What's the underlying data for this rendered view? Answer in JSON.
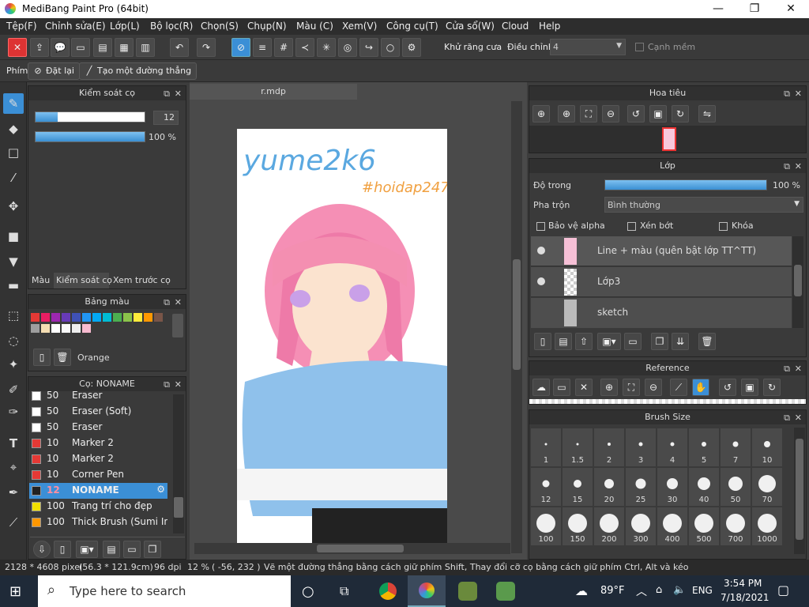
{
  "window": {
    "title": "MediBang Paint Pro (64bit)",
    "minimize": "—",
    "maximize": "❐",
    "close": "✕"
  },
  "menu": [
    "Tệp(F)",
    "Chỉnh sửa(E)",
    "Lớp(L)",
    "Bộ lọc(R)",
    "Chọn(S)",
    "Chụp(N)",
    "Màu (C)",
    "Xem(V)",
    "Công cụ(T)",
    "Cửa sổ(W)",
    "Cloud",
    "Help"
  ],
  "toolbar": {
    "antialias_label": "Khử răng cưa",
    "antialias_checked": true,
    "adjust_label": "Điều chỉnh",
    "adjust_value": "4",
    "soft_edge_label": "Cạnh mềm",
    "soft_edge_checked": false
  },
  "subbar": {
    "label": "Phím",
    "reset": "Đặt lại",
    "straight_line": "Tạo một đường thẳng"
  },
  "brush_control": {
    "title": "Kiểm soát cọ",
    "size": "12",
    "size_fill": 0.2,
    "opacity": "100 %",
    "opacity_fill": 1.0,
    "tabs": [
      "Màu",
      "Kiểm soát cọ",
      "Xem trước cọ"
    ]
  },
  "palette": {
    "title": "Bảng màu",
    "colors": [
      "#e53935",
      "#e91e63",
      "#9c27b0",
      "#673ab7",
      "#3f51b5",
      "#2196f3",
      "#03a9f4",
      "#00bcd4",
      "#4caf50",
      "#8bc34a",
      "#ffeb3b",
      "#ff9800",
      "#795548",
      "#9e9e9e",
      "#f5deb3",
      "#ffffff",
      "#fafafa",
      "#eeeeee",
      "#f8bbd0"
    ],
    "selected_name": "Orange"
  },
  "brushes": {
    "title": "Cọ: NONAME",
    "items": [
      {
        "size": "50",
        "name": "Eraser",
        "color": "#ffffff"
      },
      {
        "size": "50",
        "name": "Eraser (Soft)",
        "color": "#ffffff"
      },
      {
        "size": "50",
        "name": "Eraser",
        "color": "#ffffff"
      },
      {
        "size": "10",
        "name": "Marker 2",
        "color": "#e53935"
      },
      {
        "size": "10",
        "name": "Marker 2",
        "color": "#e53935"
      },
      {
        "size": "10",
        "name": "Corner Pen",
        "color": "#e53935"
      },
      {
        "size": "12",
        "name": "NONAME",
        "color": "#222222",
        "selected": true
      },
      {
        "size": "100",
        "name": "Trang trí cho đẹp",
        "color": "#f1e000"
      },
      {
        "size": "100",
        "name": "Thick Brush (Sumi Ink)",
        "color": "#ff9800"
      }
    ]
  },
  "canvas": {
    "tab": "r.mdp",
    "artwork_text_1": "yume2k6",
    "artwork_text_2": "#hoidap247"
  },
  "navigator": {
    "title": "Hoa tiêu"
  },
  "layers": {
    "title": "Lớp",
    "opacity_label": "Độ trong",
    "opacity_value": "100 %",
    "blend_label": "Pha trộn",
    "blend_value": "Bình thường",
    "protect_alpha": "Bảo vệ alpha",
    "clipping": "Xén bớt",
    "lock": "Khóa",
    "items": [
      {
        "name": "Line + màu (quên bật lớp TT^TT)",
        "visible": true
      },
      {
        "name": "Lớp3",
        "visible": true
      },
      {
        "name": "sketch",
        "visible": false
      }
    ]
  },
  "reference": {
    "title": "Reference"
  },
  "brush_size": {
    "title": "Brush Size",
    "sizes": [
      "1",
      "1.5",
      "2",
      "3",
      "4",
      "5",
      "7",
      "10",
      "12",
      "15",
      "20",
      "25",
      "30",
      "40",
      "50",
      "70",
      "100",
      "150",
      "200",
      "300",
      "400",
      "500",
      "700",
      "1000"
    ]
  },
  "status": {
    "dimensions": "2128 * 4608 pixel",
    "cm": "(56.3 * 121.9cm)",
    "dpi": "96 dpi",
    "zoom": "12 %",
    "coords": "( -56, 232 )",
    "hint": "Vẽ một đường thẳng bằng cách giữ phím Shift, Thay đổi cỡ cọ bằng cách giữ phím Ctrl, Alt và kéo"
  },
  "taskbar": {
    "search_placeholder": "Type here to search",
    "weather": "89°F",
    "lang": "ENG",
    "time": "3:54 PM",
    "date": "7/18/2021"
  }
}
